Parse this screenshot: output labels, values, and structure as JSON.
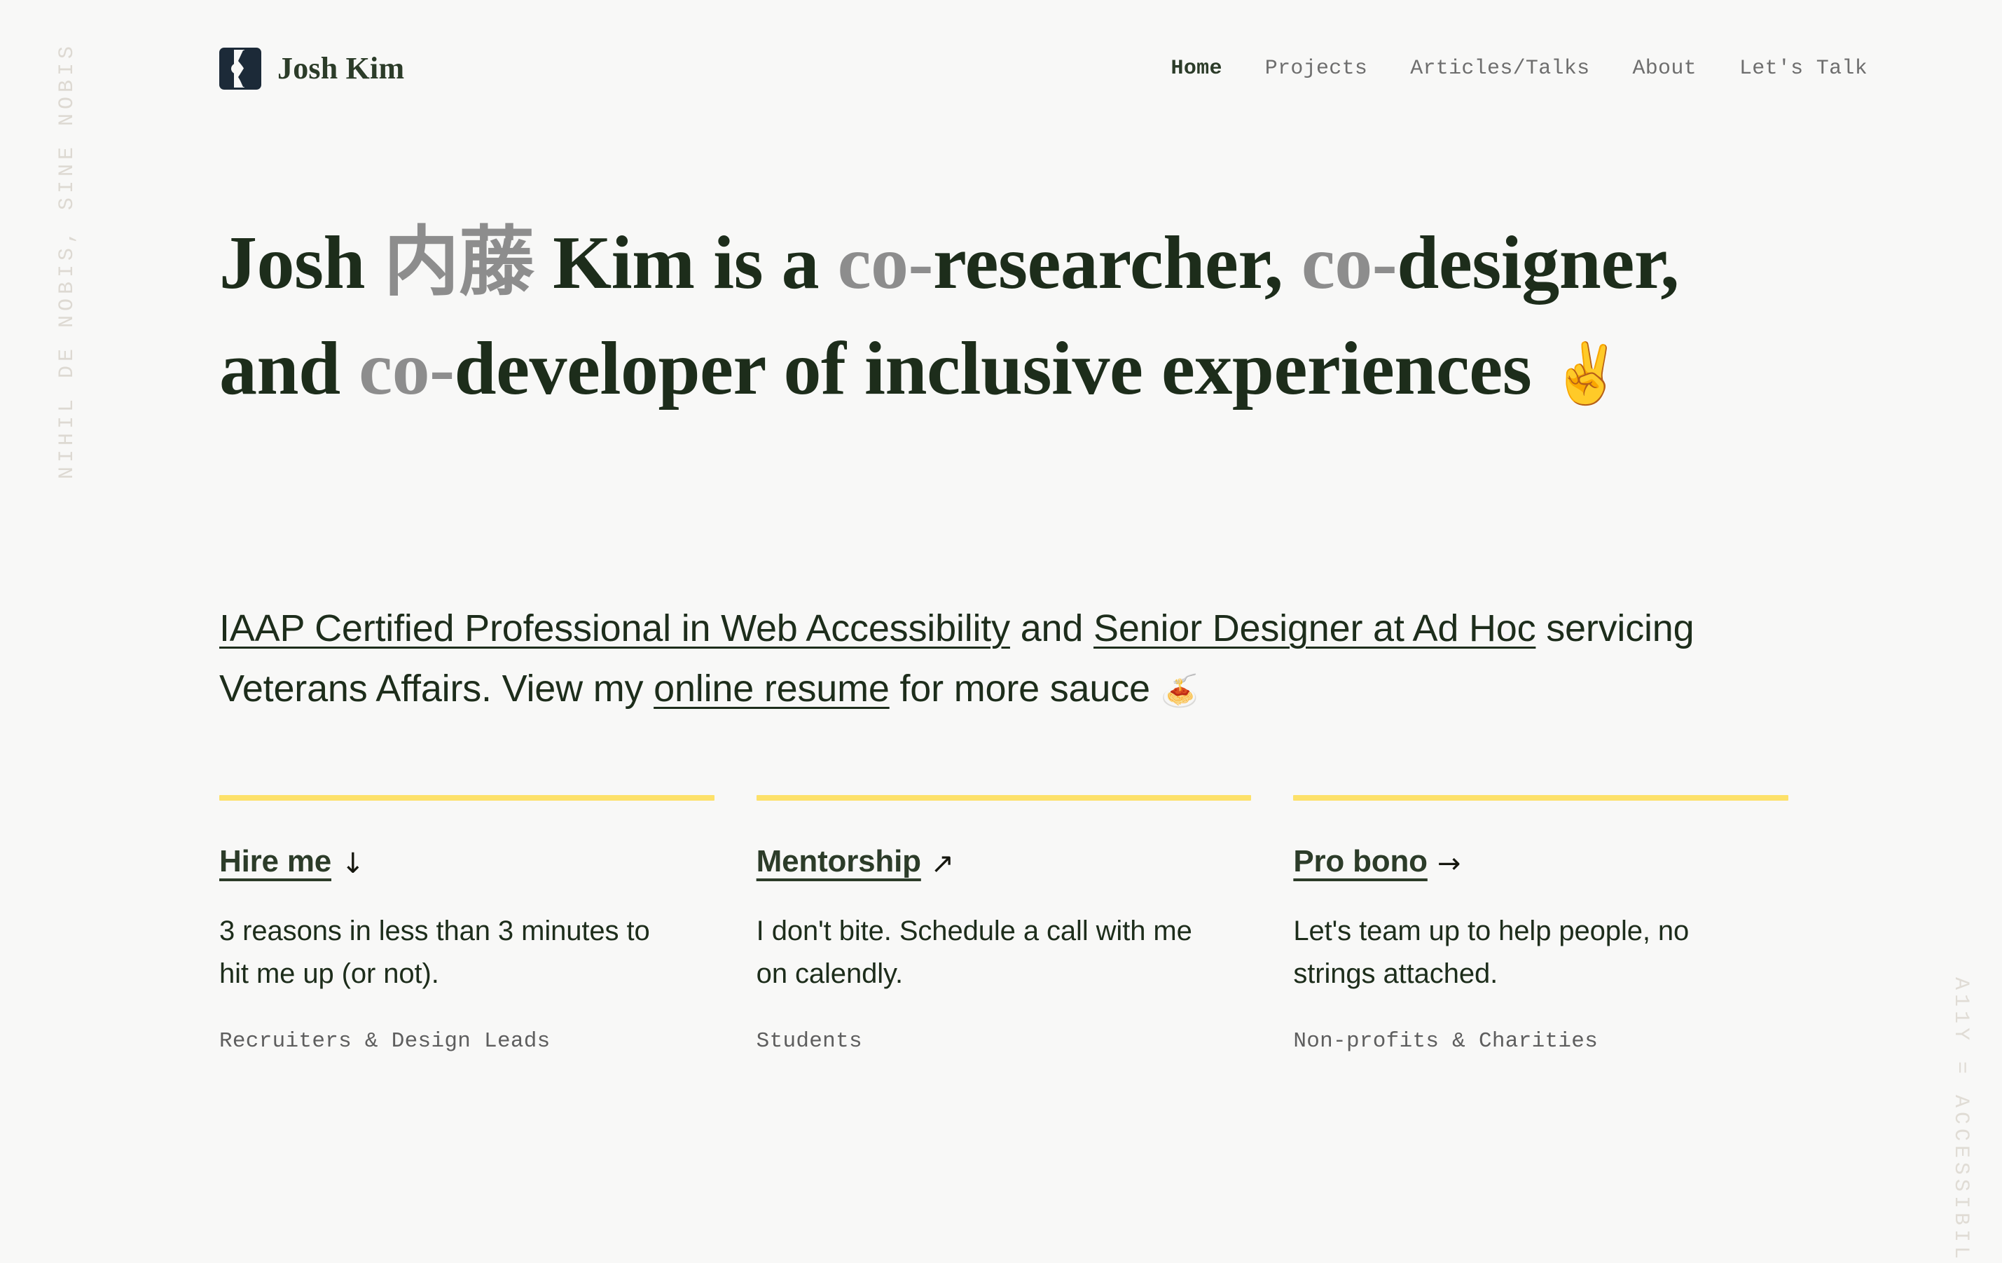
{
  "colors": {
    "background": "#f8f8f7",
    "accent_yellow": "#fde16a",
    "heading_green": "#1d2d1b",
    "brand_green": "#2c3c29",
    "muted_gray": "#8d8d8d",
    "logo_navy": "#1c2a38",
    "rail_gray": "#ddd9d2"
  },
  "rails": {
    "left_text": "NIHIL DE NOBIS, SINE NOBIS",
    "right_text": "A11Y = ACCESSIBIL"
  },
  "header": {
    "logo_icon": "josh-kim-logomark",
    "brand_name": "Josh Kim",
    "nav": [
      {
        "label": "Home",
        "active": true
      },
      {
        "label": "Projects",
        "active": false
      },
      {
        "label": "Articles/Talks",
        "active": false
      },
      {
        "label": "About",
        "active": false
      },
      {
        "label": "Let's Talk",
        "active": false
      }
    ]
  },
  "hero": {
    "title": {
      "part1": "Josh ",
      "jp_name": "内藤",
      "part2": " Kim is a ",
      "co1": "co-",
      "part3": "researcher, ",
      "co2": "co-",
      "part4": "designer, and ",
      "co3": "co-",
      "part5": "developer of inclusive experiences ",
      "emoji": "✌️"
    },
    "subtitle": {
      "link1": "IAAP Certified Professional in Web Accessibility",
      "mid1": " and ",
      "link2": "Senior Designer at Ad Hoc",
      "mid2": " servicing Veterans Affairs. View my ",
      "link3": "online resume",
      "mid3": " for more sauce ",
      "emoji": "🍝"
    }
  },
  "cards": [
    {
      "link_label": "Hire me",
      "arrow_icon": "arrow-down-icon",
      "arrow_glyph": "↓",
      "body": "3 reasons in less than 3 minutes to hit me up (or not).",
      "audience": "Recruiters & Design Leads"
    },
    {
      "link_label": "Mentorship",
      "arrow_icon": "arrow-up-right-icon",
      "arrow_glyph": "↗",
      "body": "I don't bite. Schedule a call with me on calendly.",
      "audience": "Students"
    },
    {
      "link_label": "Pro bono",
      "arrow_icon": "arrow-right-icon",
      "arrow_glyph": "→",
      "body": "Let's team up to help people, no strings attached.",
      "audience": "Non-profits & Charities"
    }
  ]
}
